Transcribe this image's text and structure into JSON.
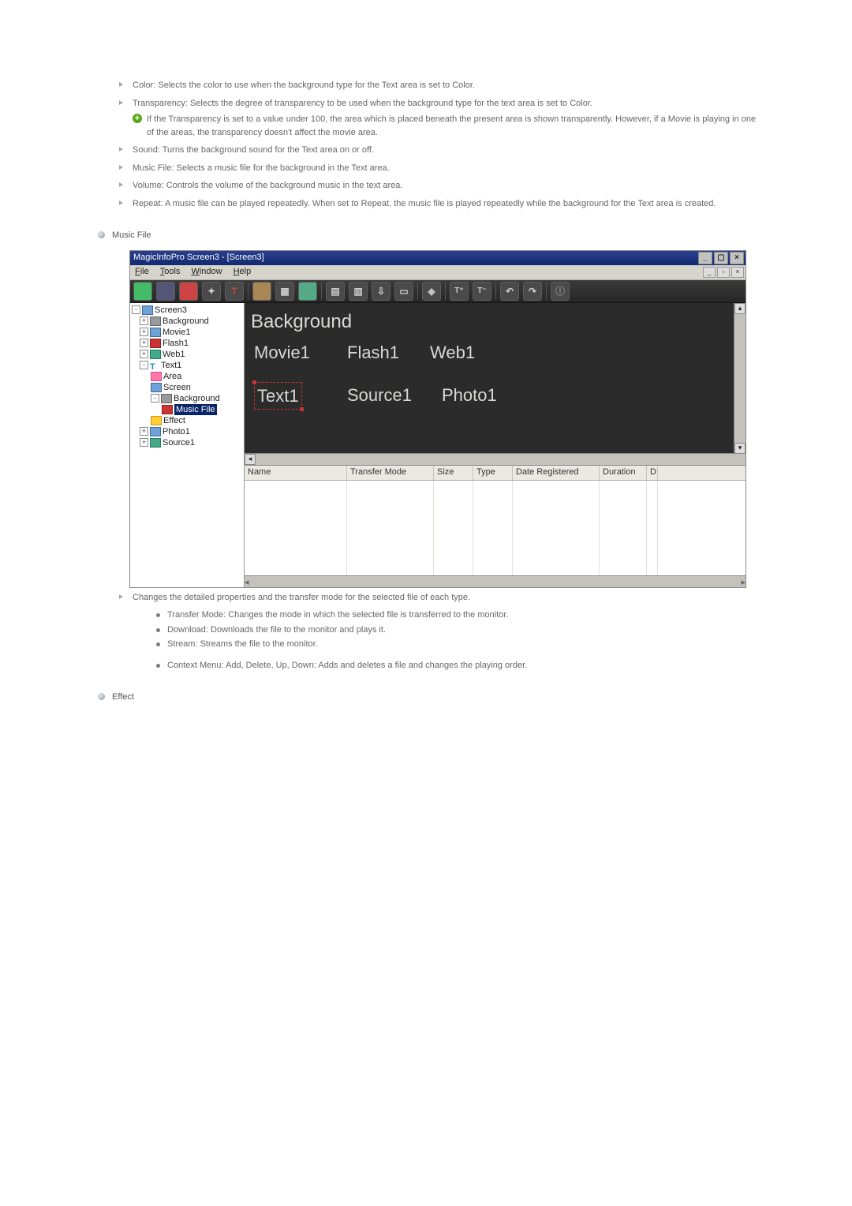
{
  "bullets": {
    "color": "Color: Selects the color to use when the background type for the Text area is set to Color.",
    "transparency": "Transparency: Selects the degree of transparency to be used when the background type for the text area is set to Color.",
    "transparency_note": "If the Transparency is set to a value under 100, the area which is placed beneath the present area is shown transparently. However, if a Movie is playing in one of the areas, the transparency doesn't affect the movie area.",
    "sound": "Sound: Turns the background sound for the Text area on or off.",
    "music_file": "Music File: Selects a music file for the background in the Text area.",
    "volume": "Volume: Controls the volume of the background music in the text area.",
    "repeat": "Repeat: A music file can be played repeatedly. When set to Repeat, the music file is played repeatedly while the background for the Text area is created."
  },
  "sections": {
    "music_file": "Music File",
    "effect": "Effect"
  },
  "window": {
    "title": "MagicInfoPro Screen3 - [Screen3]",
    "menu": {
      "file": "File",
      "tools": "Tools",
      "window": "Window",
      "help": "Help"
    },
    "toolbar_letters": [
      "",
      "",
      "",
      "",
      "T",
      "",
      "",
      "",
      "",
      "",
      "",
      "",
      "",
      "",
      "",
      "",
      "",
      ""
    ],
    "tree": {
      "root": "Screen3",
      "items": [
        "Background",
        "Movie1",
        "Flash1",
        "Web1",
        "Text1",
        "Area",
        "Screen",
        "Background",
        "Music File",
        "Effect",
        "Photo1",
        "Source1"
      ]
    },
    "canvas": {
      "bg": "Background",
      "movie": "Movie1",
      "flash": "Flash1",
      "web": "Web1",
      "text": "Text1",
      "source": "Source1",
      "photo": "Photo1"
    },
    "table_headers": {
      "name": "Name",
      "transfer": "Transfer Mode",
      "size": "Size",
      "type": "Type",
      "date": "Date Registered",
      "duration": "Duration"
    }
  },
  "post_image": "Changes the detailed properties and the transfer mode for the selected file of each type.",
  "dot_items": {
    "a": "Transfer Mode: Changes the mode in which the selected file is transferred to the monitor.",
    "b": "Download: Downloads the file to the monitor and plays it.",
    "c": "Stream: Streams the file to the monitor.",
    "d": "Context Menu: Add, Delete, Up, Down: Adds and deletes a file and changes the playing order."
  }
}
